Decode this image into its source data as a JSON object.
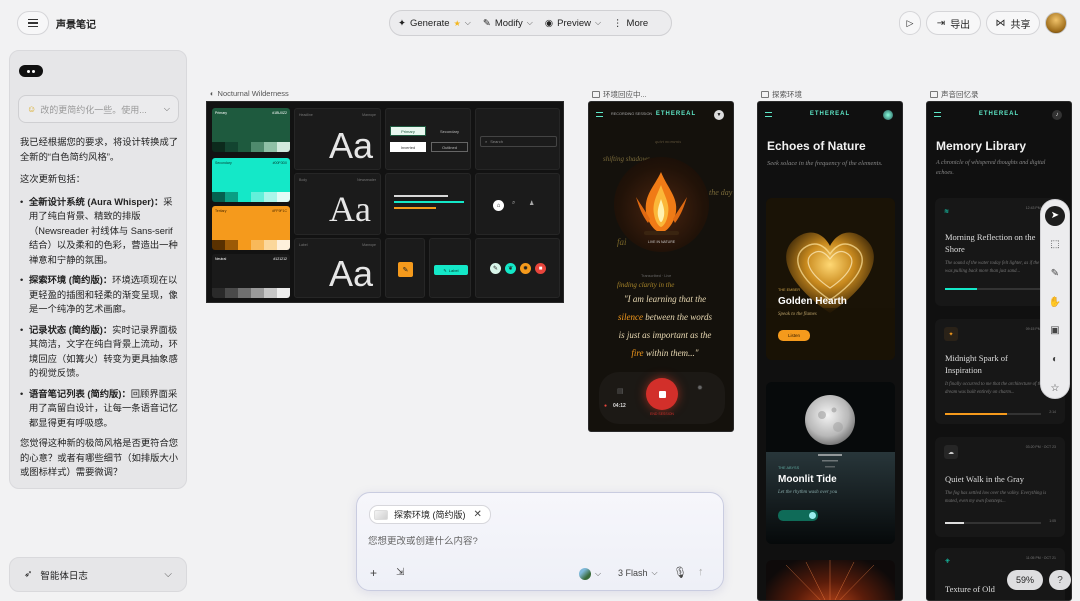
{
  "app": {
    "title": "声景笔记"
  },
  "toolbar": {
    "generate": "Generate",
    "modify": "Modify",
    "preview": "Preview",
    "more": "More"
  },
  "header_actions": {
    "export": "导出",
    "share": "共享"
  },
  "chat": {
    "collapsed_message": "改的更简约化一些。使用...",
    "intro": "我已经根据您的要求，将设计转换成了全新的“白色简约风格”。",
    "updates_heading": "这次更新包括：",
    "bullets": [
      {
        "bold": "全新设计系统 (Aura Whisper)：",
        "text": "采用了纯白背景、精致的排版（Newsreader 衬线体与 Sans-serif 结合）以及柔和的色彩，营造出一种禅意和宁静的氛围。"
      },
      {
        "bold": "探索环境 (简约版)：",
        "text": "环境选项现在以更轻盈的插图和轻柔的渐变呈现，像是一个纯净的艺术画廊。"
      },
      {
        "bold": "记录状态 (简约版)：",
        "text": "实时记录界面极其简洁，文字在纯白背景上流动，环境回应（如篝火）转变为更具抽象感的视觉反馈。"
      },
      {
        "bold": "语音笔记列表 (简约版)：",
        "text": "回顾界面采用了高留白设计，让每一条语音记忆都显得更有呼吸感。"
      }
    ],
    "closing": "您觉得这种新的极简风格是否更符合您的心意？或者有哪些细节（如排版大小或图标样式）需要微调？"
  },
  "agent_log": {
    "label": "智能体日志"
  },
  "frames": {
    "style_guide": {
      "label": "Nocturnal Wilderness",
      "colors": [
        {
          "name": "Primary",
          "hex": "#1BU0Z2",
          "color": "#1e5a3e"
        },
        {
          "name": "Secondary",
          "hex": "#00F0D0",
          "color": "#14e8c8"
        },
        {
          "name": "Tertiary",
          "hex": "#FF9F1C",
          "color": "#f59a1c"
        },
        {
          "name": "Neutral",
          "hex": "#121212",
          "color": "#1a1a1a"
        }
      ],
      "typography": [
        {
          "role": "Headline",
          "font": "Manrope",
          "sample": "Aa"
        },
        {
          "role": "Body",
          "font": "Newsreader",
          "sample": "Aa"
        },
        {
          "role": "Label",
          "font": "Manrope",
          "sample": "Aa"
        }
      ],
      "buttons": {
        "primary": "Primary",
        "secondary": "Secondary",
        "inverted": "Inverted",
        "outlined": "Outlined"
      },
      "search_placeholder": "Search",
      "label_chip": "Label"
    },
    "recording": {
      "label": "环境回应中...",
      "brand": "ETHEREAL",
      "session": "RECORDING SESSION",
      "whisper_words": [
        "shifting shadows",
        "quiet moments",
        "the day",
        "fai"
      ],
      "image_caption": "LIVE IN NATURE",
      "transcript_meta": "Transcribed · Live",
      "quote_intro": "finding clarity in the",
      "quote": [
        {
          "text": "\"I am learning that the",
          "accent": ""
        },
        {
          "text": " between the words",
          "accent": "silence"
        },
        {
          "text": "is just as important as the",
          "accent": ""
        },
        {
          "text": " within them...\"",
          "accent": "fire"
        }
      ],
      "timer": "04:12",
      "end_label": "END SESSION"
    },
    "explore": {
      "label": "探索环境",
      "brand": "ETHEREAL",
      "title": "Echoes of Nature",
      "subtitle": "Seek solace in the frequency of the elements.",
      "card1_tag": "THE EMBER",
      "card1_title": "Golden Hearth",
      "card1_sub": "Speak to the flames",
      "card1_btn": "Listen",
      "card2_tag": "THE ABYSS",
      "card2_title": "Moonlit Tide",
      "card2_sub": "Let the rhythm wash over you"
    },
    "library": {
      "label": "声音回忆录",
      "brand": "ETHEREAL",
      "title": "Memory Library",
      "subtitle": "A chronicle of whispered thoughts and digital echoes.",
      "items": [
        {
          "title": "Morning Reflection on the Shore",
          "date": "12:43 PM · OCT 24",
          "desc": "The sound of the water today felt lighter, as if the tide was pulling back more than just sand...",
          "progress": 0.3,
          "color": "#14e8c8"
        },
        {
          "title": "Midnight Spark of Inspiration",
          "date": "09:15 PM · OCT 24",
          "desc": "It finally occurred to me that the architecture of the dream was built entirely on charm...",
          "progress": 0.65,
          "color": "#f59a1c",
          "time": "2:14"
        },
        {
          "title": "Quiet Walk in the Gray",
          "date": "03:20 PM · OCT 23",
          "desc": "The fog has settled low over the valley. Everything is muted, even my own footsteps...",
          "progress": 0.2,
          "color": "#dddddd",
          "time": "1:05"
        },
        {
          "title": "Texture of Old",
          "date": "11:05 PM · OCT 21"
        }
      ]
    }
  },
  "zoom": "59%",
  "help": "?",
  "composer": {
    "chip_label": "探索环境 (简约版)",
    "placeholder": "您想更改或创建什么内容?",
    "model": "3 Flash"
  }
}
